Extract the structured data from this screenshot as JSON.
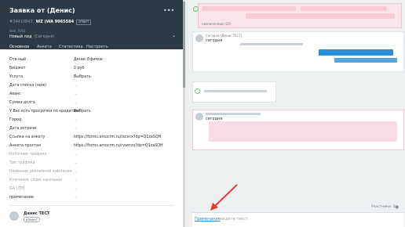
{
  "lead": {
    "title": "Заявка от (Денис)",
    "menu_icon": "more-dots-icon",
    "id": "#34410843",
    "id_extra": "WZ (WA 9965584",
    "badge": "ответ",
    "sub_small": "Веб ЛИД",
    "stage": "Новый лид",
    "stage_suffix": "(Сегодня)"
  },
  "tabs": [
    "Основное",
    "Анкета",
    "Статистика",
    "Настроить"
  ],
  "fields": [
    {
      "label": "Отв-ный",
      "value": "Денис Ефимов"
    },
    {
      "label": "Бюджет",
      "value": "0 руб"
    },
    {
      "label": "Услуга",
      "value": "Выбрать"
    },
    {
      "label": "Дата списка (ниж)",
      "value": "..."
    },
    {
      "label": "Аванс",
      "value": "..."
    },
    {
      "label": "Сумма долга",
      "value": "..."
    },
    {
      "label": "У Вас есть просрочки по кредитам?",
      "value": "Выбрать"
    },
    {
      "label": "Город",
      "value": "..."
    },
    {
      "label": "Дата встречи",
      "value": "..."
    },
    {
      "label": "Ссылка на анкету",
      "value": "https://forms.amocrm.ru/rxcvcx?dp=Q1zaSQH"
    },
    {
      "label": "Анкета простая",
      "value": "https://forms.amocrm.ru/rvwrrzx?dp=Q1zaSQH"
    },
    {
      "label": "Источник трафика",
      "value": "..."
    },
    {
      "label": "Тип трафика",
      "value": "..."
    },
    {
      "label": "Название рекламной кампании",
      "value": "..."
    },
    {
      "label": "Ключевое слово кампании",
      "value": "..."
    },
    {
      "label": "GA UTM",
      "value": "..."
    },
    {
      "label": "примечание",
      "value": "..."
    }
  ],
  "contact": {
    "name": "Денис ТЕСТ",
    "badge": "клиент"
  },
  "feed": {
    "msg1_time": "назначенные (20)",
    "msg2_author": "Сегодня (Денис ТЕСТ)",
    "msg2_text": "сегодня",
    "msg3_text": "сегодня"
  },
  "note": {
    "label": "Примечание",
    "placeholder": "введите текст"
  },
  "participants": "Участники: 0"
}
